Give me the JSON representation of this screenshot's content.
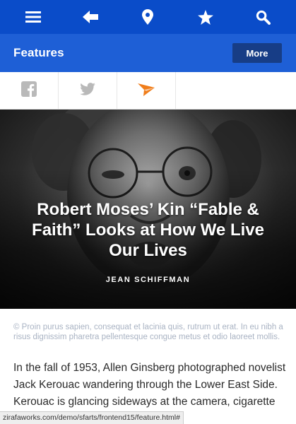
{
  "nav": {
    "icons": [
      "menu-icon",
      "back-arrow-icon",
      "location-pin-icon",
      "star-icon",
      "search-icon"
    ],
    "bg_color": "#0a4cc9"
  },
  "subheader": {
    "title": "Features",
    "more_label": "More",
    "bg_color": "#1e5fd6"
  },
  "share": {
    "icons": [
      "facebook-icon",
      "twitter-icon",
      "send-icon"
    ],
    "accent": "#f07d1a"
  },
  "article": {
    "headline": "Robert Moses’ Kin “Fable & Faith” Looks at How We Live Our Lives",
    "byline": "JEAN SCHIFFMAN",
    "caption": "© Proin purus sapien, consequat et lacinia quis, rutrum ut erat. In eu nibh a risus dignissim pharetra pellentesque congue metus et odio laoreet mollis.",
    "body": "In the fall of 1953, Allen Ginsberg photographed novelist Jack Kerouac wandering through the Lower East Side. Kerouac is glancing sideways at the camera, cigarette dangling from his lips. A statue in"
  },
  "status_url": "zirafaworks.com/demo/sfarts/frontend15/feature.html#"
}
